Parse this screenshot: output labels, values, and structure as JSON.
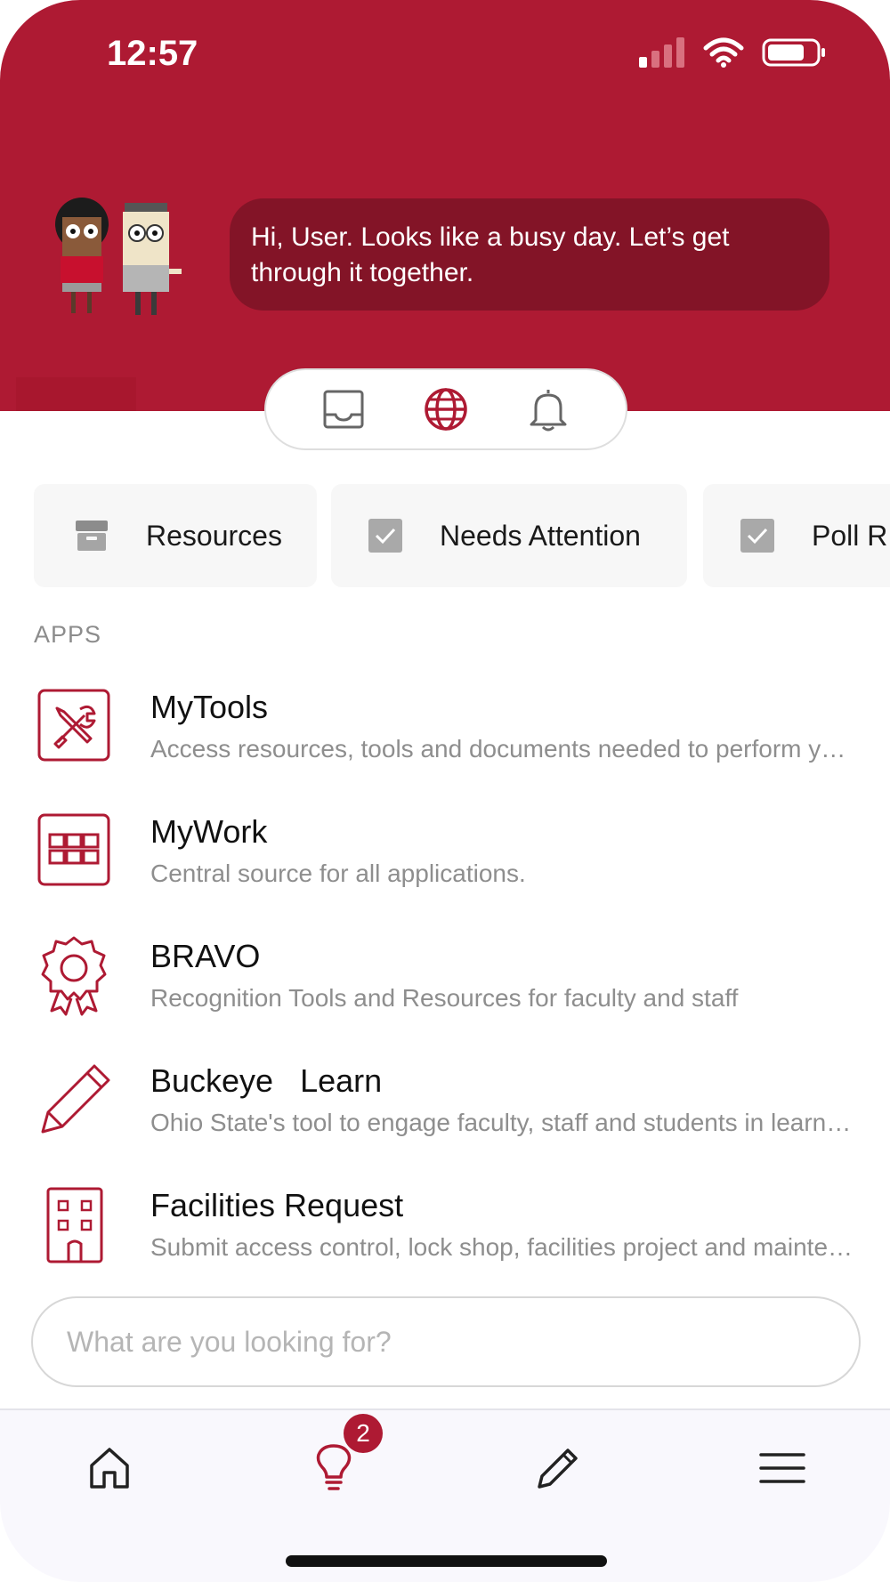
{
  "status_bar": {
    "time": "12:57"
  },
  "greeting": {
    "message": "Hi, User. Looks like a busy day. Let’s get through it together."
  },
  "switcher": {
    "items": [
      "inbox-icon",
      "globe-icon",
      "bell-icon"
    ],
    "active": "globe-icon"
  },
  "chips": [
    {
      "label": "Resources",
      "icon": "archive-box-icon"
    },
    {
      "label": "Needs Attention",
      "icon": "checkbox-icon"
    },
    {
      "label": "Poll R",
      "icon": "checkbox-icon"
    }
  ],
  "apps_heading": "APPS",
  "apps": [
    {
      "title": "MyTools",
      "description": "Access resources, tools and documents needed to perform your job",
      "icon": "tools-icon"
    },
    {
      "title": "MyWork",
      "description": "Central source for all applications.",
      "icon": "grid-icon"
    },
    {
      "title": "BRAVO",
      "description": "Recognition Tools and Resources for faculty and staff",
      "icon": "award-ribbon-icon"
    },
    {
      "title": "Buckeye   Learn",
      "description": "Ohio State's tool to engage faculty, staff and students in learning",
      "icon": "pencil-icon"
    },
    {
      "title": "Facilities Request",
      "description": "Submit access control, lock shop, facilities project and maintenance requests",
      "icon": "building-icon"
    }
  ],
  "search": {
    "placeholder": "What are you looking for?",
    "value": ""
  },
  "tabbar": {
    "items": [
      "home-icon",
      "lightbulb-icon",
      "pencil-icon",
      "menu-icon"
    ],
    "badge_count": "2"
  },
  "colors": {
    "brand": "#ae1a33",
    "bubble": "#831427",
    "text": "#111111",
    "muted": "#8e8e8e"
  }
}
